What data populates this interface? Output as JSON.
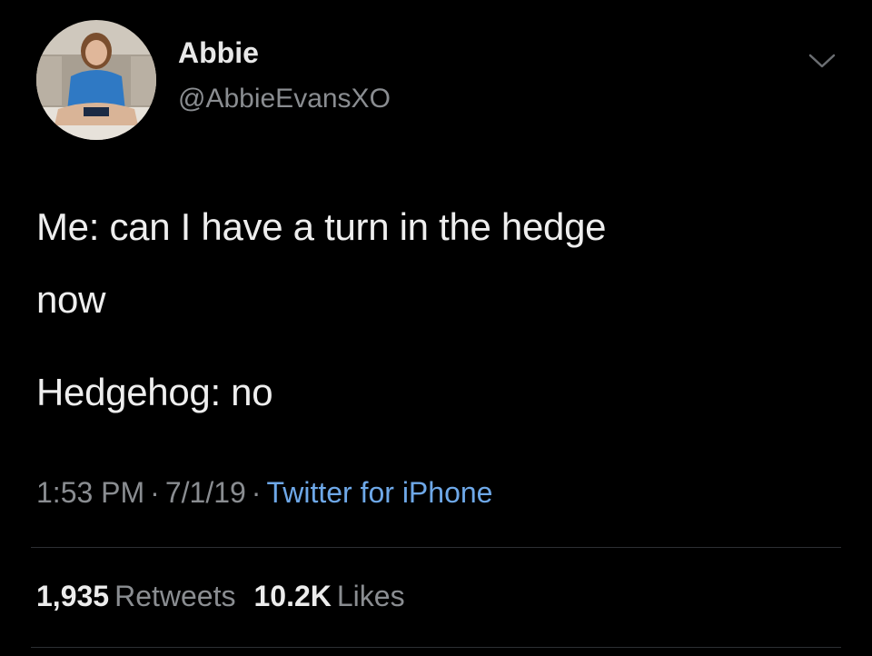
{
  "tweet": {
    "author": {
      "display_name": "Abbie",
      "handle": "@AbbieEvansXO"
    },
    "menu_icon": "chevron-down-icon",
    "text_lines": [
      "Me: can I have a turn in the hedge",
      "now",
      "Hedgehog: no"
    ],
    "meta": {
      "time": "1:53 PM",
      "separator": "·",
      "date": "7/1/19",
      "source": "Twitter for iPhone"
    },
    "stats": {
      "retweets_count": "1,935",
      "retweets_label": "Retweets",
      "likes_count": "10.2K",
      "likes_label": "Likes"
    }
  },
  "colors": {
    "background": "#000000",
    "primary_text": "#eeeeee",
    "secondary_text": "#8a8d91",
    "link": "#6ea8e8",
    "divider": "#2c2f33"
  }
}
